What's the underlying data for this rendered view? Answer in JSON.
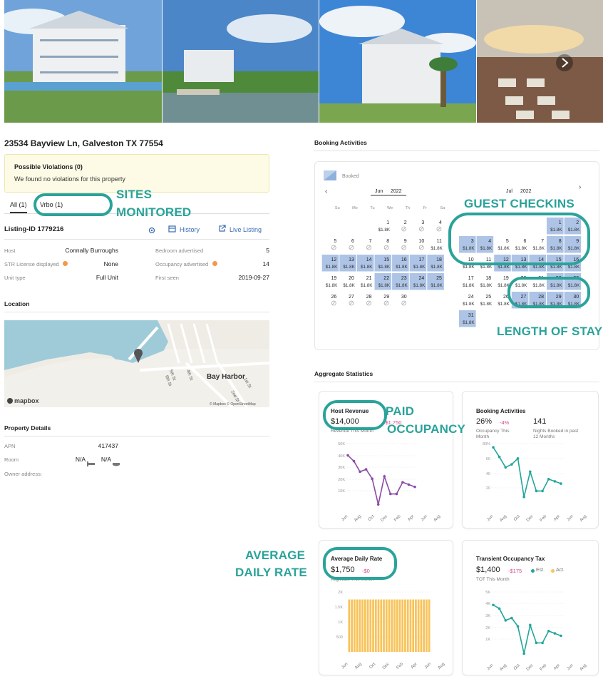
{
  "address": "23534 Bayview Ln, Galveston TX 77554",
  "violations": {
    "title": "Possible Violations (0)",
    "desc": "We found no violations for this property"
  },
  "tabs": [
    {
      "label": "All (1)"
    },
    {
      "label": "Vrbo (1)"
    }
  ],
  "listing": {
    "id": "Listing-ID 1779216",
    "history": "History",
    "live": "Live Listing"
  },
  "details": {
    "host_l": "Host",
    "host_v": "Connally Burroughs",
    "str_l": "STR License displayed",
    "str_v": "None",
    "unit_l": "Unit type",
    "unit_v": "Full Unit",
    "bed_l": "Bedroom advertised",
    "bed_v": "5",
    "occ_l": "Occupancy advertised",
    "occ_v": "14",
    "seen_l": "First seen",
    "seen_v": "2019-09-27"
  },
  "location": {
    "title": "Location",
    "place": "Bay Harbor",
    "streets": [
      "5th St",
      "4th St",
      "6th St",
      "1st St",
      "2nd St"
    ],
    "logo": "mapbox",
    "credit": "© Mapbox © OpenStreetMap"
  },
  "property": {
    "title": "Property Details",
    "apn_l": "APN",
    "apn_v": "417437",
    "room_l": "Room",
    "room_v1": "N/A",
    "room_v2": "N/A",
    "owner_l": "Owner address:"
  },
  "booking": {
    "title": "Booking Activities",
    "legend": "Booked",
    "june": {
      "month": "Jun",
      "year": "2022"
    },
    "july": {
      "month": "Jul",
      "year": "2022"
    },
    "weekdays": [
      "Su",
      "Mo",
      "Tu",
      "We",
      "Th",
      "Fr",
      "Sa"
    ],
    "price": "$1.8K"
  },
  "aggregate": {
    "title": "Aggregate Statistics"
  },
  "host_revenue": {
    "title": "Host Revenue",
    "value": "$14,000",
    "delta": "-$1,750",
    "sub": "Revenue This Month",
    "yticks": [
      "50K",
      "40K",
      "30K",
      "20K",
      "10K"
    ],
    "values": [
      40,
      35,
      26,
      28,
      20,
      -2,
      22,
      7,
      7,
      17,
      15,
      13
    ]
  },
  "booking_stats": {
    "title": "Booking Activities",
    "pct": "26%",
    "pct_delta": "-4%",
    "pct_sub1": "Occupancy This",
    "pct_sub2": "Month",
    "nights": "141",
    "nights_sub1": "Nights Booked in past",
    "nights_sub2": "12 Months",
    "yticks": [
      "80%",
      "60",
      "40",
      "20"
    ],
    "values": [
      75,
      62,
      48,
      52,
      60,
      8,
      42,
      16,
      16,
      32,
      29,
      26
    ]
  },
  "adr": {
    "title": "Average Daily Rate",
    "value": "$1,750",
    "delta": "-$0",
    "sub": "Avg Rate This Month",
    "yticks": [
      "2K",
      "1.5K",
      "1K",
      "500"
    ],
    "values": [
      1750,
      1750,
      1750,
      1750,
      1750,
      1750,
      1750,
      1750,
      1750,
      1750,
      1750,
      1750,
      1750,
      1750,
      1750,
      1750,
      1750,
      1750,
      1750,
      1750,
      1750,
      1750,
      1750,
      1750,
      1750,
      1750,
      1750,
      1750,
      1750,
      1750,
      1750
    ]
  },
  "tot": {
    "title": "Transient Occupancy Tax",
    "value": "$1,400",
    "delta": "-$175",
    "est": "Est.",
    "act": "Act.",
    "sub": "TOT This Month",
    "yticks": [
      "5K",
      "4K",
      "3K",
      "2K",
      "1K"
    ],
    "values": [
      3.9,
      3.6,
      2.6,
      2.8,
      2.1,
      -0.2,
      2.2,
      0.7,
      0.7,
      1.7,
      1.5,
      1.3
    ]
  },
  "xmonths": [
    "Jun",
    "Aug",
    "Oct",
    "Dec",
    "Feb",
    "Apr",
    "Jun",
    "Aug"
  ],
  "annotations": {
    "sites": "SITES",
    "monitored": "MONITORED",
    "checkins": "GUEST CHECKINS",
    "length": "LENGTH OF STAY",
    "paid": "PAID",
    "occupancy": "OCCUPANCY",
    "average": "AVERAGE",
    "daily": "DAILY RATE"
  },
  "colors": {
    "teal": "#2aa39a",
    "booked": "#aec4e6",
    "purple": "#8b4aa6",
    "line_teal": "#22a69a",
    "bar": "#f7c35a"
  }
}
